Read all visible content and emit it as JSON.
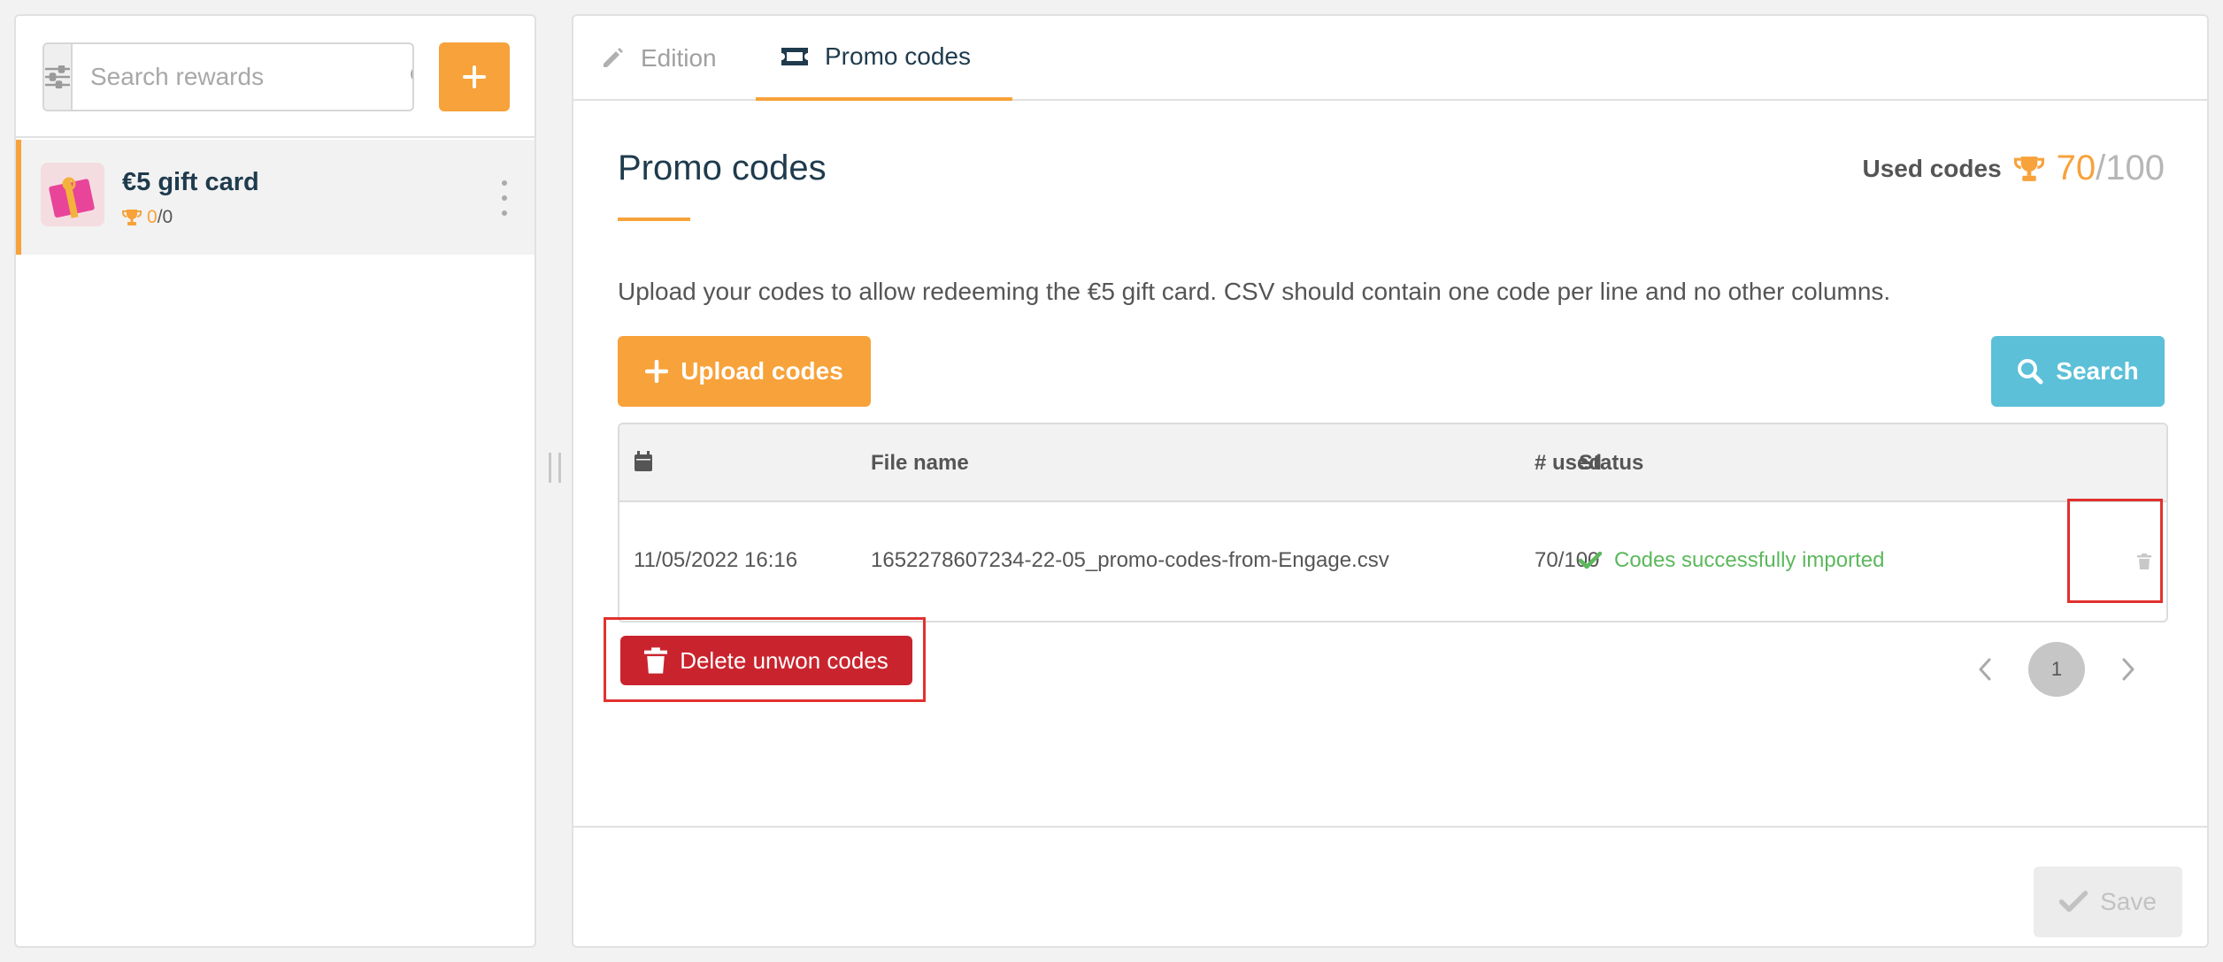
{
  "sidebar": {
    "search": {
      "placeholder": "Search rewards"
    },
    "add_button": {
      "icon": "plus-icon"
    },
    "rewards": [
      {
        "title": "€5 gift card",
        "won": "0",
        "separator": "/",
        "total": "0"
      }
    ]
  },
  "tabs": [
    {
      "label": "Edition",
      "icon": "pencil-icon",
      "active": false
    },
    {
      "label": "Promo codes",
      "icon": "ticket-icon",
      "active": true
    }
  ],
  "main": {
    "title": "Promo codes",
    "used_codes": {
      "label": "Used codes",
      "count": "70",
      "total": "/100"
    },
    "description": "Upload your codes to allow redeeming the €5 gift card. CSV should contain one code per line and no other columns.",
    "upload_button": "Upload codes",
    "search_button": "Search",
    "table": {
      "headers": {
        "date_icon": "calendar-icon",
        "file": "File name",
        "used": "# used",
        "status": "Status"
      },
      "rows": [
        {
          "date": "11/05/2022 16:16",
          "file": "1652278607234-22-05_promo-codes-from-Engage.csv",
          "used": "70/100",
          "status": "Codes successfully imported"
        }
      ]
    },
    "delete_unwon_button": "Delete unwon codes",
    "pagination": {
      "current": "1"
    },
    "save_button": "Save"
  },
  "colors": {
    "accent": "#f7a23a",
    "info": "#5bc0d8",
    "danger": "#c9242e",
    "success": "#5cb85c",
    "highlight": "#e1312f",
    "heading": "#1f3b4d"
  }
}
